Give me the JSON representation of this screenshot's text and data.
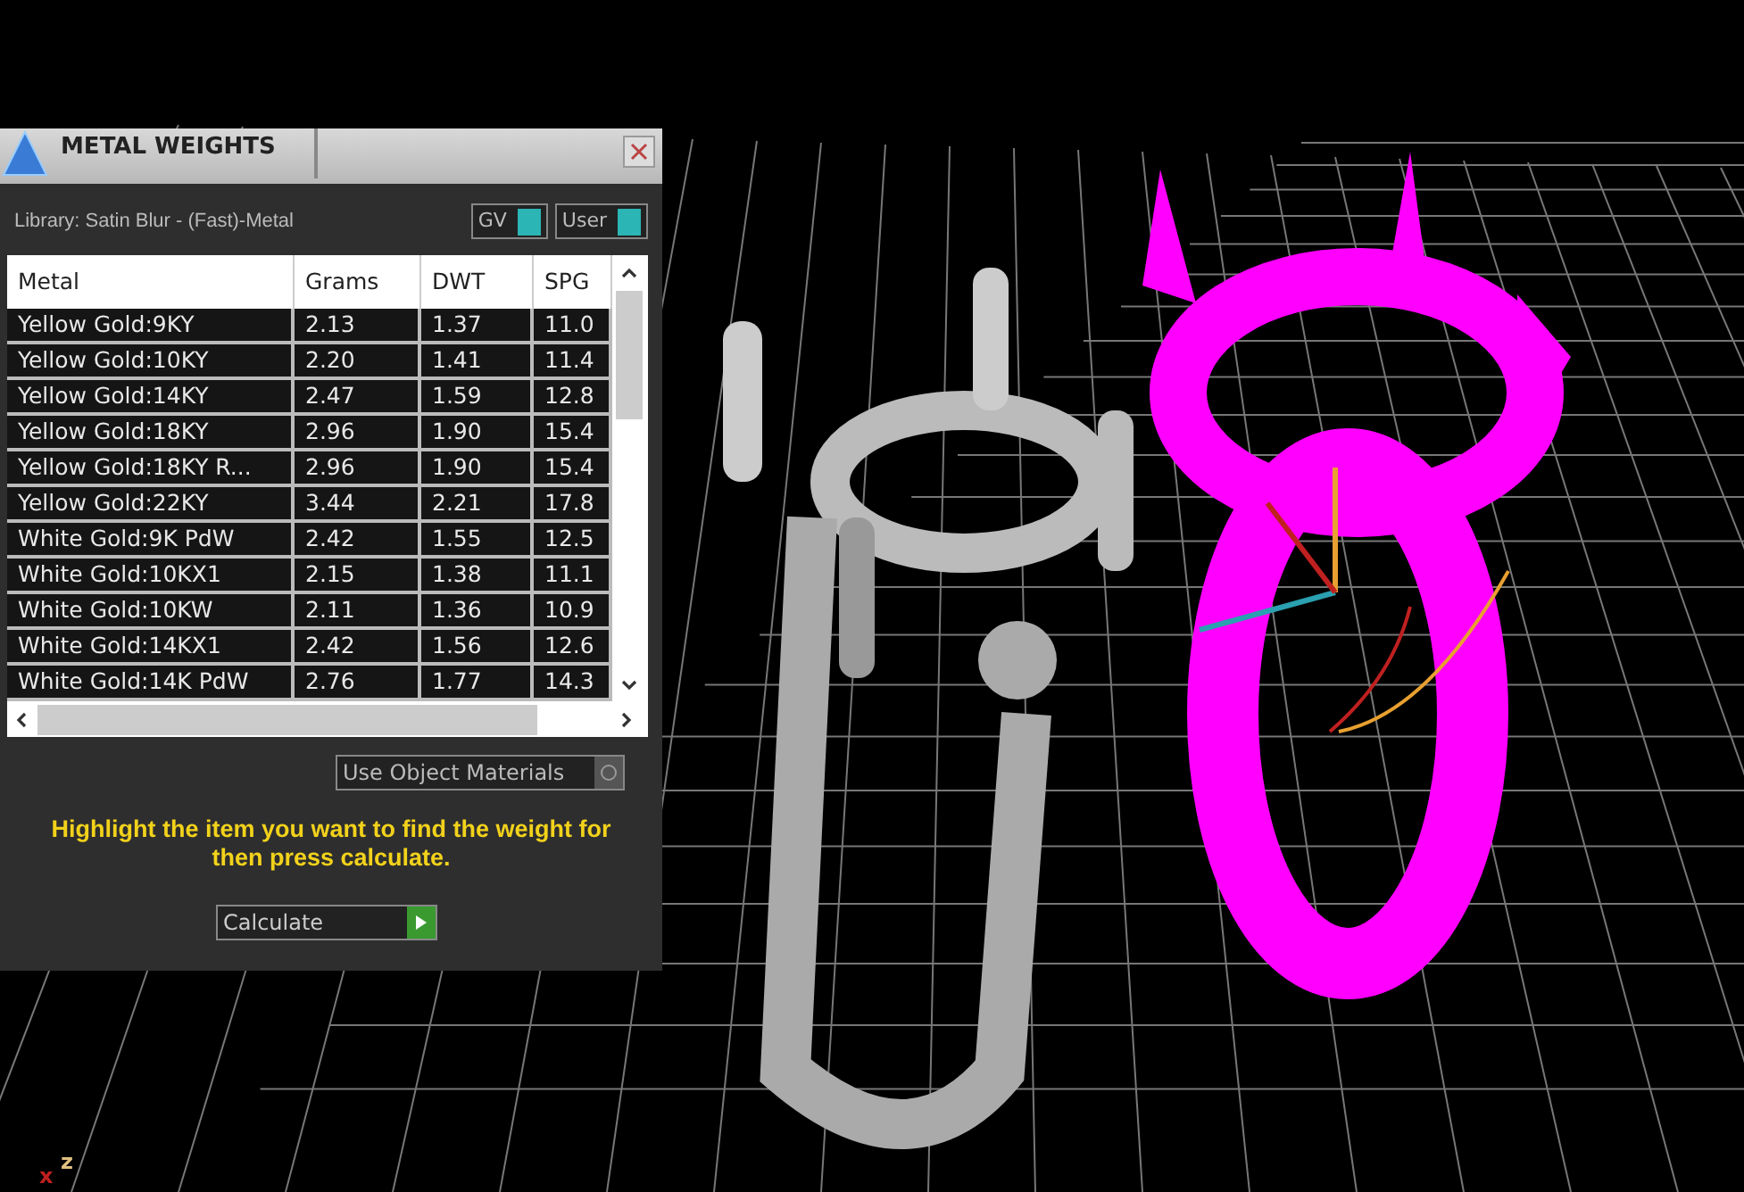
{
  "panel": {
    "title": "METAL WEIGHTS",
    "library": "Library: Satin Blur - (Fast)-Metal",
    "toggles": [
      {
        "label": "GV",
        "on": true
      },
      {
        "label": "User",
        "on": true
      }
    ],
    "table": {
      "columns": [
        "Metal",
        "Grams",
        "DWT",
        "SPG"
      ],
      "rows": [
        {
          "cells": [
            "Yellow Gold:9KY",
            "2.13",
            "1.37",
            "11.0"
          ],
          "selected": false
        },
        {
          "cells": [
            "Yellow Gold:10KY",
            "2.20",
            "1.41",
            "11.4"
          ],
          "selected": false
        },
        {
          "cells": [
            "Yellow Gold:14KY",
            "2.47",
            "1.59",
            "12.8"
          ],
          "selected": false
        },
        {
          "cells": [
            "Yellow Gold:18KY",
            "2.96",
            "1.90",
            "15.4"
          ],
          "selected": false
        },
        {
          "cells": [
            "Yellow Gold:18KY R...",
            "2.96",
            "1.90",
            "15.4"
          ],
          "selected": false
        },
        {
          "cells": [
            "Yellow Gold:22KY",
            "3.44",
            "2.21",
            "17.8"
          ],
          "selected": false
        },
        {
          "cells": [
            "White Gold:9K PdW",
            "2.42",
            "1.55",
            "12.5"
          ],
          "selected": false
        },
        {
          "cells": [
            "White Gold:10KX1",
            "2.15",
            "1.38",
            "11.1"
          ],
          "selected": false
        },
        {
          "cells": [
            "White Gold:10KW",
            "2.11",
            "1.36",
            "10.9"
          ],
          "selected": false
        },
        {
          "cells": [
            "White Gold:14KX1",
            "2.42",
            "1.56",
            "12.6"
          ],
          "selected": false
        },
        {
          "cells": [
            "White Gold:14K PdW",
            "2.76",
            "1.77",
            "14.3"
          ],
          "selected": false
        }
      ]
    },
    "use_object_materials": {
      "label": "Use Object Materials",
      "checked": false
    },
    "hint": "Highlight the item you want to find the weight for then press calculate.",
    "calculate_button": "Calculate"
  },
  "viewport": {
    "axis_labels": [
      {
        "label": "x",
        "color": "#c02020"
      },
      {
        "label": "z",
        "color": "#e0c080"
      }
    ]
  }
}
